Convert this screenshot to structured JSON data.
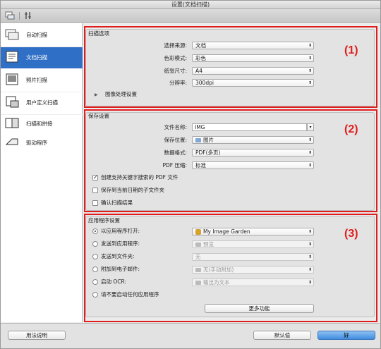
{
  "window": {
    "title": "设置(文档扫描)"
  },
  "toolbar": {
    "icons": [
      "scan-from-computer-icon",
      "general-settings-icon"
    ]
  },
  "sidebar": {
    "items": [
      {
        "label": "自动扫描",
        "icon": "auto-scan-icon",
        "selected": false
      },
      {
        "label": "文档扫描",
        "icon": "document-scan-icon",
        "selected": true
      },
      {
        "label": "照片扫描",
        "icon": "photo-scan-icon",
        "selected": false
      },
      {
        "label": "用户定义扫描",
        "icon": "custom-scan-icon",
        "selected": false
      },
      {
        "label": "扫描和拼接",
        "icon": "scan-stitch-icon",
        "selected": false
      },
      {
        "label": "驱动程序",
        "icon": "driver-icon",
        "selected": false
      }
    ]
  },
  "callouts": {
    "one": "(1)",
    "two": "(2)",
    "three": "(3)"
  },
  "scan_options": {
    "title": "扫描选项",
    "source_label": "选择来源:",
    "source_value": "文档",
    "color_label": "色彩模式:",
    "color_value": "彩色",
    "paper_label": "纸张尺寸:",
    "paper_value": "A4",
    "resolution_label": "分辨率:",
    "resolution_value": "300dpi",
    "image_processing_label": "图像处理设置"
  },
  "save_settings": {
    "title": "保存设置",
    "filename_label": "文件名称:",
    "filename_value": "IMG",
    "location_label": "保存位置:",
    "location_value": "图片",
    "format_label": "数据格式:",
    "format_value": "PDF(多页)",
    "compression_label": "PDF 压缩:",
    "compression_value": "标准",
    "check_keyword": {
      "label": "创建支持关键字搜索的 PDF 文件",
      "checked": true
    },
    "check_subfolder": {
      "label": "保存到当前日期的子文件夹",
      "checked": false
    },
    "check_confirm": {
      "label": "确认扫描结果",
      "checked": false
    }
  },
  "app_settings": {
    "title": "应用程序设置",
    "opt_open": {
      "label": "以应用程序打开:",
      "value": "My Image Garden",
      "selected": true
    },
    "opt_send_app": {
      "label": "发送到应用程序:",
      "value": "预览",
      "selected": false
    },
    "opt_send_folder": {
      "label": "发送到文件夹:",
      "value": "无",
      "selected": false
    },
    "opt_email": {
      "label": "附加到电子邮件:",
      "value": "无(手动附加)",
      "selected": false
    },
    "opt_ocr": {
      "label": "启动 OCR:",
      "value": "输出为文本",
      "selected": false
    },
    "opt_none": {
      "label": "请不要启动任何应用程序",
      "selected": false
    },
    "more_button": "更多功能"
  },
  "footer": {
    "help_button": "用法说明",
    "defaults_button": "默认值",
    "ok_button": "好"
  },
  "colors": {
    "selection": "#2f6fc6",
    "callout": "#e01d1d",
    "ok_button": "#3f8de0"
  }
}
